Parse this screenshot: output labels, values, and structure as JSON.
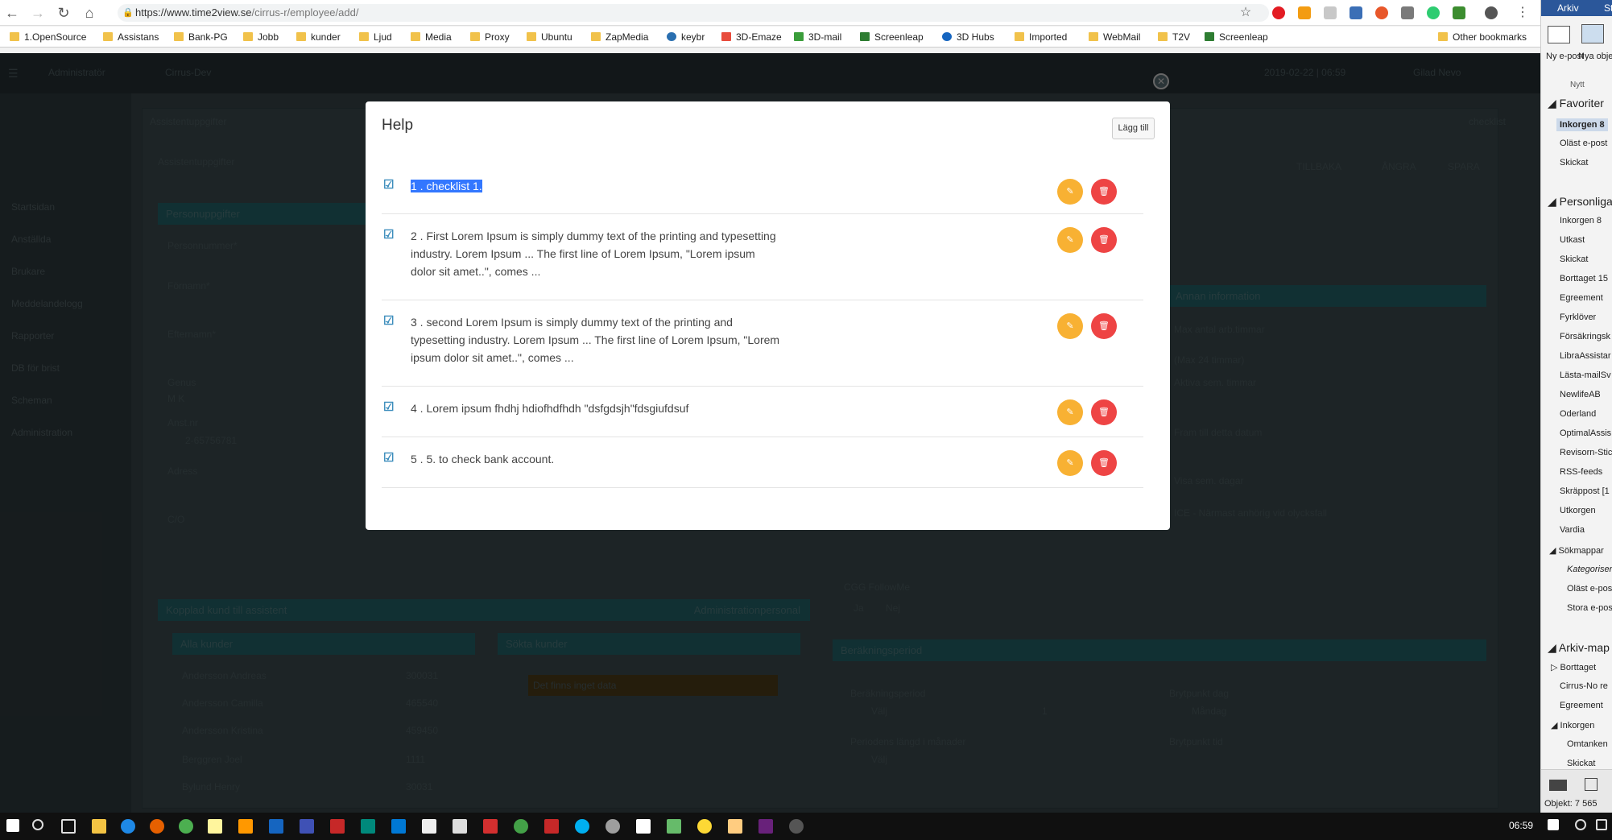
{
  "browser": {
    "url_host": "https://www.time2view.se",
    "url_path": "/cirrus-r/employee/add/",
    "bookmarks": [
      "1.OpenSource",
      "Assistans",
      "Bank-PG",
      "Jobb",
      "kunder",
      "Ljud",
      "Media",
      "Proxy",
      "Ubuntu",
      "ZapMedia",
      "keybr",
      "3D-Emaze",
      "3D-mail",
      "Screenleap",
      "3D Hubs",
      "Imported",
      "WebMail",
      "T2V",
      "Screenleap"
    ],
    "other_bookmarks": "Other bookmarks"
  },
  "app": {
    "role": "Administratör",
    "client": "Cirrus-Dev",
    "datetime": "2019-02-22 | 06:59",
    "user": "Gilad Nevo",
    "section_title": "Assistentuppgifter",
    "section_sub": "Assistentuppgifter",
    "nav": [
      "Startsidan",
      "Anställda",
      "Brukare",
      "Meddelandelogg",
      "Rapporter",
      "DB för brist",
      "Scheman",
      "Administration"
    ],
    "toolbar": {
      "back": "TILLBAKA",
      "cancel": "ÅNGRA",
      "save": "SPARA"
    },
    "checklist_tag": "checklist",
    "personal_panel": "Personuppgifter",
    "fields": [
      "Personnummer*",
      "Förnamn*",
      "Efternamn*",
      "Genus",
      "Anst.nr",
      "Adress",
      "C/O"
    ],
    "genus_options": "M  K",
    "anst_nr": "2-65756781",
    "other_info": "Annan information",
    "other_fields": [
      "Max antal arb.timmar",
      "(Max 24 timmar)",
      "Aktiva sem. timmar",
      "Fram till detta datum",
      "Visa sem. dagar",
      "ICE - Närmast anhörig vid olycksfall"
    ],
    "followme": "CGG FollowMe",
    "followme_yes": "Ja",
    "followme_no": "Nej",
    "kopplad": "Kopplad kund till assistent",
    "adminpersonal": "Administrationpersonal",
    "alla_kunder": "Alla kunder",
    "sokta_kunder": "Sökta kunder",
    "no_customers": "Det finns inget data",
    "kunder": [
      {
        "name": "Andersson Andreas",
        "id": "300031"
      },
      {
        "name": "Andersson Camilla",
        "id": "465540"
      },
      {
        "name": "Andersson Kristina",
        "id": "459450"
      },
      {
        "name": "Berggren Joel",
        "id": "1111"
      },
      {
        "name": "Bylund Henry",
        "id": "30031"
      }
    ],
    "berakning": "Beräkningsperiod",
    "ber_fields": [
      "Beräkningsperiod",
      "Brytpunkt dag",
      "Periodens längd i månader",
      "Brytpunkt tid"
    ],
    "ber_values": [
      "Välj",
      "1",
      "Måndag",
      "Välj"
    ]
  },
  "modal": {
    "title": "Help",
    "add_label": "Lägg till",
    "items": [
      {
        "text": "1 . checklist 1.",
        "checked": true,
        "selected": true
      },
      {
        "text": "2 . First Lorem Ipsum is simply dummy text of the printing and typesetting industry. Lorem Ipsum ... The first line of Lorem Ipsum, \"Lorem ipsum dolor sit amet..\", comes ...",
        "checked": true
      },
      {
        "text": "3 . second Lorem Ipsum is simply dummy text of the printing and typesetting industry. Lorem Ipsum ... The first line of Lorem Ipsum, \"Lorem ipsum dolor sit amet..\", comes ...",
        "checked": true
      },
      {
        "text": "4 . Lorem ipsum fhdhj hdiofhdfhdh \"dsfgdsjh\"fdsgiufdsuf",
        "checked": true
      },
      {
        "text": "5 . 5. to check bank account.",
        "checked": true
      }
    ]
  },
  "outlook": {
    "ribbon": [
      "Arkiv",
      "St"
    ],
    "new_email": "Ny e-post",
    "new_items": "Nya objekt",
    "new_group": "Nytt",
    "favorites": "Favoriter",
    "fav_items": [
      "Inkorgen 8",
      "Oläst e-post",
      "Skickat"
    ],
    "personal": "Personliga",
    "personal_items": [
      "Inkorgen 8",
      "Utkast",
      "Skickat",
      "Borttaget 15",
      "Egreement",
      "Fyrklöver",
      "Försäkringsk",
      "LibraAssistar",
      "Lästa-mailSv",
      "NewlifeAB",
      "Oderland",
      "OptimalAssis",
      "Revisorn-Stic",
      "RSS-feeds",
      "Skräppost [1",
      "Utkorgen",
      "Vardia",
      "Sökmappar",
      "Kategoriser",
      "Oläst e-pos",
      "Stora e-pos"
    ],
    "archive": "Arkiv-map",
    "archive_items": [
      "Borttaget",
      "Cirrus-No re",
      "Egreement",
      "Inkorgen",
      "Omtanken",
      "Skickat"
    ],
    "status": "Objekt: 7 565"
  },
  "taskbar": {
    "time": "06:59"
  },
  "colors": {
    "edit": "#f8b133",
    "delete": "#ee4444",
    "check": "#3c8dbc",
    "selection": "#3377ff"
  }
}
